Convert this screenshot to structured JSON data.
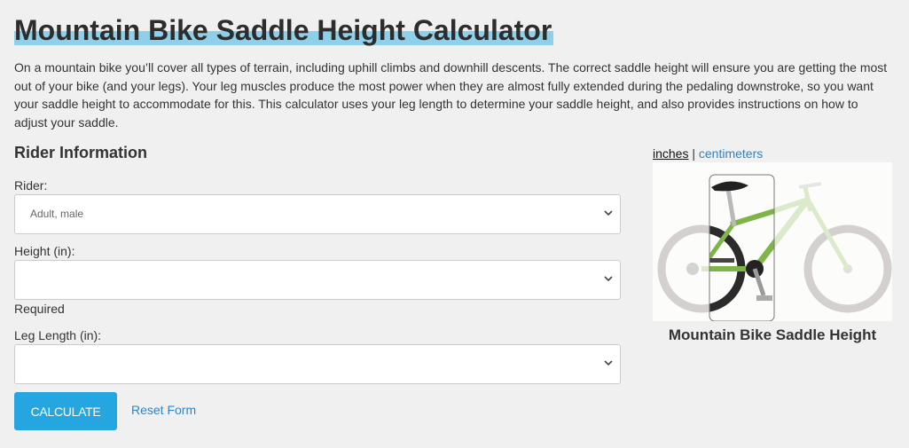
{
  "page": {
    "title": "Mountain Bike Saddle Height Calculator",
    "intro": "On a mountain bike you’ll cover all types of terrain, including uphill climbs and downhill descents. The correct saddle height will ensure you are getting the most out of your bike (and your legs). Your leg muscles produce the most power when they are almost fully extended during the pedaling downstroke, so you want your saddle height to accommodate for this. This calculator uses your leg length to determine your saddle height, and also provides instructions on how to adjust your saddle."
  },
  "form": {
    "section_title": "Rider Information",
    "rider": {
      "label": "Rider:",
      "value": "Adult, male"
    },
    "height": {
      "label": "Height (in):",
      "value": "",
      "required_text": "Required"
    },
    "leg_length": {
      "label": "Leg Length (in):",
      "value": ""
    },
    "calculate_label": "CALCULATE",
    "reset_label": "Reset Form"
  },
  "units": {
    "inches": "inches",
    "separator": " | ",
    "centimeters": "centimeters"
  },
  "figure": {
    "caption": "Mountain Bike Saddle Height"
  },
  "colors": {
    "accent": "#25a6e0",
    "link": "#2e84c4",
    "highlight": "#8ecfea",
    "frame_green": "#8dc04f"
  }
}
